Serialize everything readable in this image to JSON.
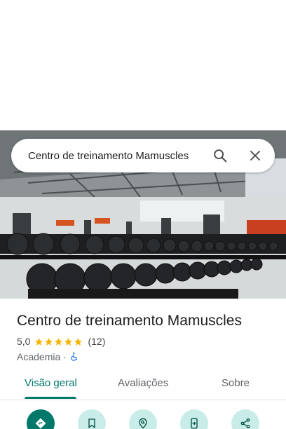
{
  "search": {
    "query": "Centro de treinamento Mamuscles"
  },
  "place": {
    "name": "Centro de treinamento Mamuscles",
    "rating": "5,0",
    "stars": 5,
    "reviews": "(12)",
    "category": "Academia",
    "separator": "·"
  },
  "tabs": [
    {
      "label": "Visão geral",
      "active": true
    },
    {
      "label": "Avaliações",
      "active": false
    },
    {
      "label": "Sobre",
      "active": false
    }
  ],
  "actions": [
    {
      "icon": "directions-icon"
    },
    {
      "icon": "bookmark-icon"
    },
    {
      "icon": "nearby-pin-icon"
    },
    {
      "icon": "send-to-phone-icon"
    },
    {
      "icon": "share-icon"
    }
  ],
  "colors": {
    "accent": "#00796b",
    "action_bg": "#c8ece8",
    "star": "#f5b400",
    "accessibility": "#1a73e8"
  }
}
